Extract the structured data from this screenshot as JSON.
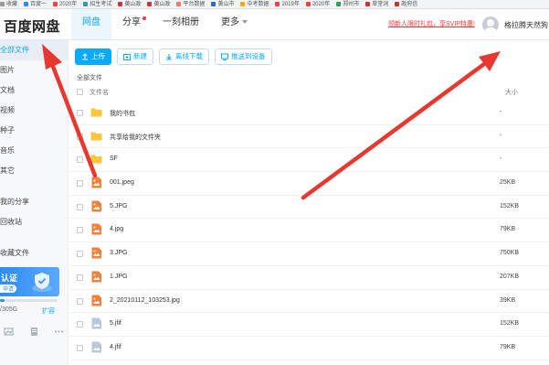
{
  "bookmarks": [
    {
      "label": "收藏",
      "color": "#999999"
    },
    {
      "label": "百度一",
      "color": "#2e8cf0"
    },
    {
      "label": "2020年",
      "color": "#e44"
    },
    {
      "label": "招生考试",
      "color": "#39a"
    },
    {
      "label": "黄山政",
      "color": "#c33"
    },
    {
      "label": "黄山政",
      "color": "#c33"
    },
    {
      "label": "平台数据",
      "color": "#e77"
    },
    {
      "label": "黄山市",
      "color": "#36c"
    },
    {
      "label": "中考数据",
      "color": "#fa0"
    },
    {
      "label": "2019年",
      "color": "#e44"
    },
    {
      "label": "2020年",
      "color": "#e44"
    },
    {
      "label": "郑州市",
      "color": "#396"
    },
    {
      "label": "草堂词",
      "color": "#c33"
    },
    {
      "label": "政府信",
      "color": "#c33"
    }
  ],
  "header": {
    "logo": "百度网盘",
    "nav": [
      {
        "label": "网盘",
        "active": true,
        "dot": false,
        "caret": false
      },
      {
        "label": "分享",
        "active": false,
        "dot": true,
        "caret": false
      },
      {
        "label": "一刻相册",
        "active": false,
        "dot": false,
        "caret": false
      },
      {
        "label": "更多",
        "active": false,
        "dot": false,
        "caret": true
      }
    ],
    "promo": "领新人限时礼包，享SVIP特惠!",
    "username": "格拉腾天然狗"
  },
  "sidebar": {
    "items": [
      {
        "label": "全部文件",
        "active": true
      },
      {
        "label": "图片",
        "active": false
      },
      {
        "label": "文档",
        "active": false
      },
      {
        "label": "视频",
        "active": false
      },
      {
        "label": "种子",
        "active": false
      },
      {
        "label": "音乐",
        "active": false
      },
      {
        "label": "其它",
        "active": false
      },
      {
        "label": "我的分享",
        "active": false
      },
      {
        "label": "回收站",
        "active": false
      },
      {
        "label": "收藏文件",
        "active": false
      }
    ],
    "promo_title": "认证",
    "promo_sub": "申请",
    "quota_fraction": 0.08,
    "quota_text": "/305G",
    "expand": "扩容"
  },
  "toolbar": {
    "upload": "上传",
    "new_folder": "新建",
    "offline": "离线下载",
    "push": "推送到设备"
  },
  "crumb": "全部文件",
  "list": {
    "col_name": "文件名",
    "col_size": "大小",
    "rows": [
      {
        "name": "我的书包",
        "size": "-",
        "type": "folder"
      },
      {
        "name": "共享给我的文件夹",
        "size": "-",
        "type": "folder"
      },
      {
        "name": "SF",
        "size": "-",
        "type": "folder"
      },
      {
        "name": "001.jpeg",
        "size": "25KB",
        "type": "image"
      },
      {
        "name": "5.JPG",
        "size": "152KB",
        "type": "image"
      },
      {
        "name": "4.jpg",
        "size": "79KB",
        "type": "image"
      },
      {
        "name": "3.JPG",
        "size": "750KB",
        "type": "image"
      },
      {
        "name": "1.JPG",
        "size": "207KB",
        "type": "image"
      },
      {
        "name": "2_20210112_103253.jpg",
        "size": "39KB",
        "type": "image"
      },
      {
        "name": "5.jfif",
        "size": "152KB",
        "type": "file"
      },
      {
        "name": "4.jfif",
        "size": "79KB",
        "type": "file"
      }
    ]
  },
  "colors": {
    "accent": "#09aaff",
    "arrow": "#e8372f",
    "folder": "#ffc43b",
    "image": "#f3813b",
    "jfif": "#b8c7da"
  }
}
